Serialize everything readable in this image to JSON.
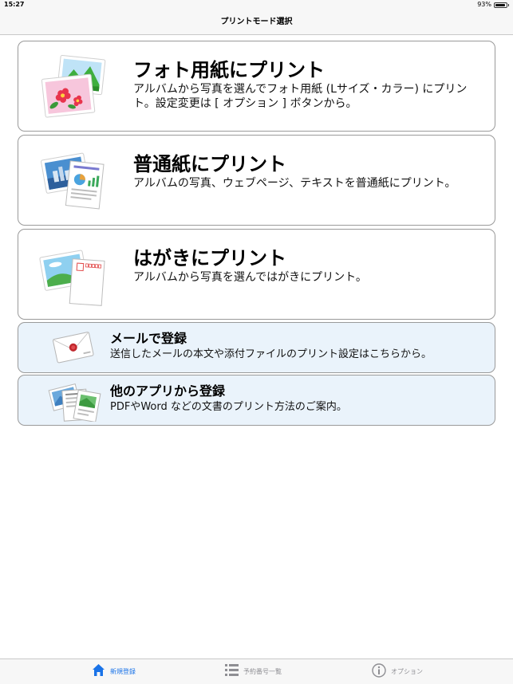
{
  "status_bar": {
    "time": "15:27",
    "battery_text": "93%",
    "battery_level": 0.93
  },
  "nav": {
    "title": "プリントモード選択"
  },
  "cards": [
    {
      "title": "フォト用紙にプリント",
      "description": "アルバムから写真を選んでフォト用紙 (Lサイズ・カラー) にプリント。設定変更は [ オプション ] ボタンから。",
      "icon": "photo-paper-icon"
    },
    {
      "title": "普通紙にプリント",
      "description": "アルバムの写真、ウェブページ、テキストを普通紙にプリント。",
      "icon": "plain-paper-icon"
    },
    {
      "title": "はがきにプリント",
      "description": "アルバムから写真を選んではがきにプリント。",
      "icon": "postcard-icon"
    },
    {
      "title": "メールで登録",
      "description": "送信したメールの本文や添付ファイルのプリント設定はこちらから。",
      "icon": "mail-envelope-icon"
    },
    {
      "title": "他のアプリから登録",
      "description": "PDFやWord などの文書のプリント方法のご案内。",
      "icon": "documents-icon"
    }
  ],
  "tab_bar": {
    "tabs": [
      {
        "label": "新規登録",
        "icon": "home-icon",
        "active": true
      },
      {
        "label": "予約番号一覧",
        "icon": "list-icon",
        "active": false
      },
      {
        "label": "オプション",
        "icon": "info-icon",
        "active": false
      }
    ]
  },
  "colors": {
    "accent": "#1a73e8",
    "card_border": "#9a9a9a",
    "small_card_bg": "#eaf3fb"
  }
}
